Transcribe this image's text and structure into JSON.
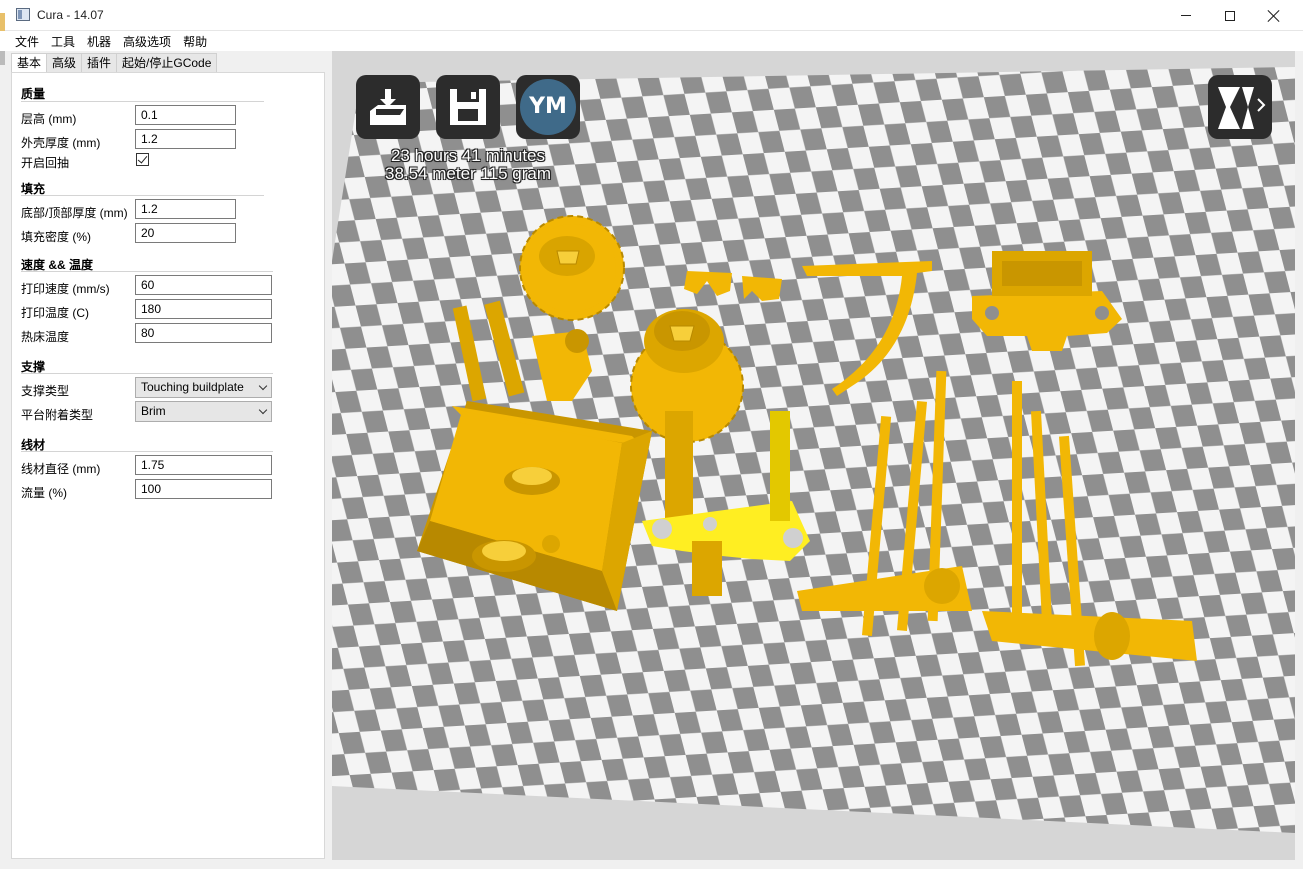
{
  "window": {
    "title": "Cura - 14.07"
  },
  "menubar": {
    "items": [
      "文件",
      "工具",
      "机器",
      "高级选项",
      "帮助"
    ]
  },
  "tabs": [
    "基本",
    "高级",
    "插件",
    "起始/停止GCode"
  ],
  "settings": {
    "quality": {
      "heading": "质量",
      "layer_height_label": "层高 (mm)",
      "layer_height_value": "0.1",
      "shell_thickness_label": "外壳厚度 (mm)",
      "shell_thickness_value": "1.2",
      "retraction_label": "开启回抽",
      "retraction_checked": true
    },
    "fill": {
      "heading": "填充",
      "bottom_top_label": "底部/顶部厚度 (mm)",
      "bottom_top_value": "1.2",
      "density_label": "填充密度 (%)",
      "density_value": "20"
    },
    "speed": {
      "heading": "速度 && 温度",
      "print_speed_label": "打印速度 (mm/s)",
      "print_speed_value": "60",
      "print_temp_label": "打印温度 (C)",
      "print_temp_value": "180",
      "bed_temp_label": "热床温度",
      "bed_temp_value": "80"
    },
    "support": {
      "heading": "支撑",
      "support_type_label": "支撑类型",
      "support_type_value": "Touching buildplate",
      "adhesion_label": "平台附着类型",
      "adhesion_value": "Brim"
    },
    "filament": {
      "heading": "线材",
      "diameter_label": "线材直径 (mm)",
      "diameter_value": "1.75",
      "flow_label": "流量 (%)",
      "flow_value": "100"
    }
  },
  "viewport": {
    "toolbar": {
      "load_icon": "load-tray-icon",
      "save_icon": "save-floppy-icon",
      "ym_label": "YM",
      "view_mode_icon": "view-mode-icon"
    },
    "print_time": "23 hours 41 minutes",
    "print_usage": "38.54 meter 115 gram",
    "colors": {
      "model": "#f2b705",
      "model_dark": "#c99600",
      "model_highlight": "#ffee22",
      "checker_dark": "#8f8f8f",
      "checker_light": "#f4f4f4"
    }
  }
}
